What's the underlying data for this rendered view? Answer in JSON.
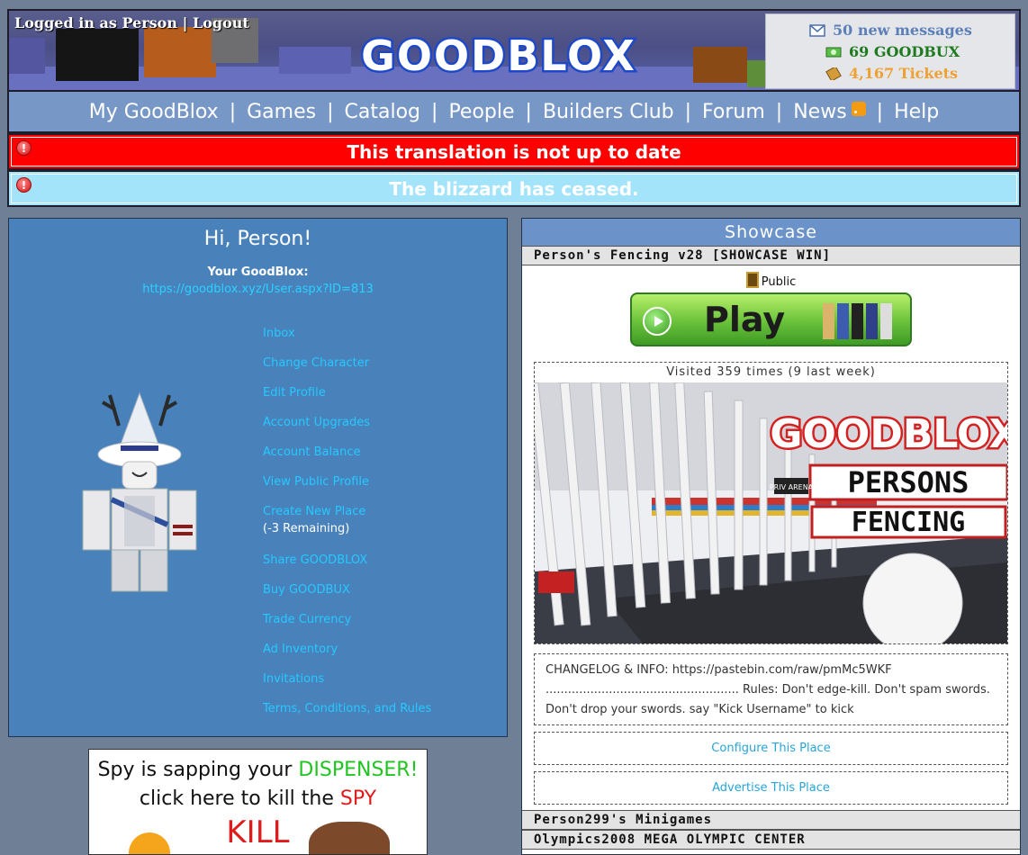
{
  "header": {
    "logged_in_text": "Logged in as Person",
    "separator": "|",
    "logout_label": "Logout",
    "logo_text": "GOODBLOX",
    "messages": "50 new messages",
    "currency": "69 GOODBUX",
    "tickets": "4,167 Tickets",
    "colors": {
      "messages": "#5b7fb8",
      "currency": "#1d7a1d",
      "tickets": "#f0a030"
    }
  },
  "nav": {
    "items": [
      "My GoodBlox",
      "Games",
      "Catalog",
      "People",
      "Builders Club",
      "Forum",
      "News",
      "Help"
    ],
    "divider": "|"
  },
  "alerts": [
    {
      "text": "This translation is not up to date",
      "color": "#ff0000"
    },
    {
      "text": "The blizzard has ceased.",
      "color": "#a3e4fb"
    }
  ],
  "profile": {
    "greeting": "Hi, Person!",
    "your_label": "Your GoodBlox:",
    "url": "https://goodblox.xyz/User.aspx?ID=813",
    "links": [
      {
        "label": "Inbox"
      },
      {
        "label": "Change Character"
      },
      {
        "label": "Edit Profile"
      },
      {
        "label": "Account Upgrades"
      },
      {
        "label": "Account Balance"
      },
      {
        "label": "View Public Profile"
      },
      {
        "label": "Create New Place",
        "sub": "(-3 Remaining)"
      },
      {
        "label": "Share GOODBLOX"
      },
      {
        "label": "Buy GOODBUX"
      },
      {
        "label": "Trade Currency"
      },
      {
        "label": "Ad Inventory"
      },
      {
        "label": "Invitations"
      },
      {
        "label": "Terms, Conditions, and Rules"
      }
    ]
  },
  "ad": {
    "line1_a": "Spy is sapping your ",
    "line1_b": "DISPENSER!",
    "line2_a": "click here to kill the ",
    "line2_b": "SPY",
    "line3": "KILL"
  },
  "showcase": {
    "title": "Showcase",
    "place_name": "Person's Fencing v28 [SHOWCASE WIN]",
    "access": "Public",
    "play_label": "Play",
    "visits": "Visited 359 times (9 last week)",
    "thumb_logo": "GOODBLOX",
    "thumb_line1": "PERSONS",
    "thumb_line2": "FENCING",
    "thumb_sign": "PRIV ARENA",
    "description": "CHANGELOG & INFO: https://pastebin.com/raw/pmMc5WKF .................................................... Rules: Don't edge-kill. Don't spam swords. Don't drop your swords. say \"Kick Username\" to kick",
    "configure_label": "Configure This Place",
    "advertise_label": "Advertise This Place",
    "other_places": [
      "Person299's Minigames",
      "Olympics2008 MEGA OLYMPIC CENTER"
    ]
  }
}
